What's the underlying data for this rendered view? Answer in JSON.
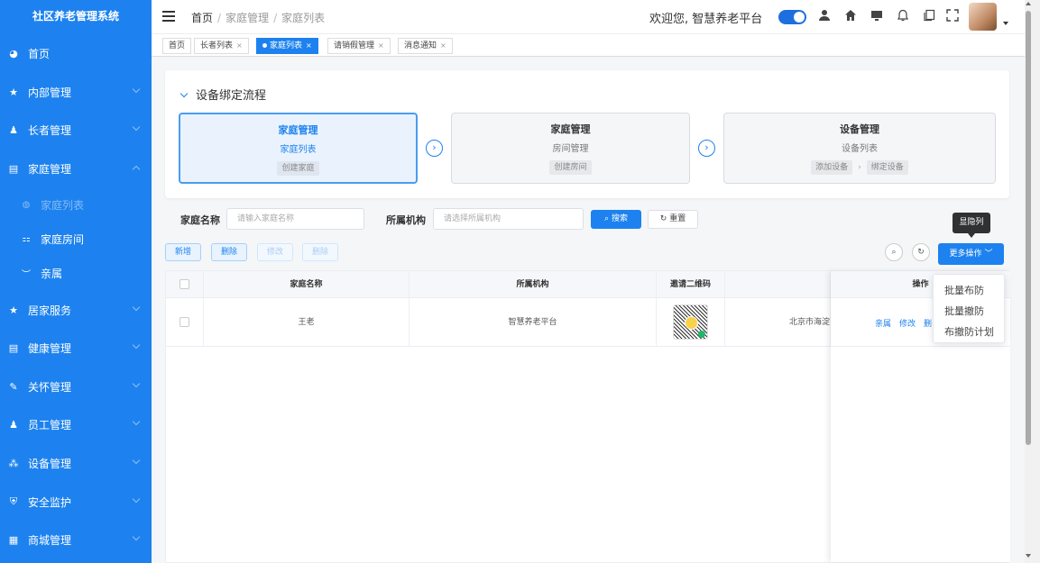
{
  "sidebar": {
    "brand": "社区养老管理系统",
    "items": [
      {
        "label": "首页",
        "icon": "dashboard-icon",
        "glyph": "◕"
      },
      {
        "label": "内部管理",
        "icon": "star-icon",
        "glyph": "★"
      },
      {
        "label": "长者管理",
        "icon": "user-icon",
        "glyph": "♟"
      },
      {
        "label": "家庭管理",
        "icon": "document-icon",
        "glyph": "▤"
      },
      {
        "label": "居家服务",
        "icon": "star-icon",
        "glyph": "★"
      },
      {
        "label": "健康管理",
        "icon": "document-icon",
        "glyph": "▤"
      },
      {
        "label": "关怀管理",
        "icon": "edit-icon",
        "glyph": "✎"
      },
      {
        "label": "员工管理",
        "icon": "user-icon",
        "glyph": "♟"
      },
      {
        "label": "设备管理",
        "icon": "device-icon",
        "glyph": "⁂"
      },
      {
        "label": "安全监护",
        "icon": "shield-icon",
        "glyph": "⛨"
      },
      {
        "label": "商城管理",
        "icon": "grid-icon",
        "glyph": "▦"
      }
    ],
    "subitems": [
      {
        "label": "家庭列表",
        "icon": "globe-icon",
        "glyph": "◍"
      },
      {
        "label": "家庭房间",
        "icon": "room-icon",
        "glyph": "⚏"
      },
      {
        "label": "亲属",
        "icon": "people-icon",
        "glyph": "︶"
      }
    ]
  },
  "header": {
    "breadcrumbs": [
      "首页",
      "家庭管理",
      "家庭列表"
    ],
    "welcome": "欢迎您, 智慧养老平台",
    "icons": [
      "person-icon",
      "home-icon",
      "monitor-icon",
      "bell-icon",
      "copy-icon",
      "fullscreen-icon"
    ]
  },
  "tabs": [
    {
      "label": "首页",
      "closable": false
    },
    {
      "label": "长者列表",
      "closable": true
    },
    {
      "label": "家庭列表",
      "closable": true,
      "active": true
    },
    {
      "label": "请销假管理",
      "closable": true
    },
    {
      "label": "消息通知",
      "closable": true
    }
  ],
  "flow": {
    "title": "设备绑定流程",
    "steps": [
      {
        "title": "家庭管理",
        "subtitle": "家庭列表",
        "buttons": [
          "创建家庭"
        ]
      },
      {
        "title": "家庭管理",
        "subtitle": "房间管理",
        "buttons": [
          "创建房间"
        ]
      },
      {
        "title": "设备管理",
        "subtitle": "设备列表",
        "buttons": [
          "添加设备",
          "绑定设备"
        ]
      }
    ]
  },
  "search": {
    "family_label": "家庭名称",
    "family_placeholder": "请输入家庭名称",
    "org_label": "所属机构",
    "org_placeholder": "请选择所属机构",
    "search_btn": "搜索",
    "reset_btn": "重置"
  },
  "toolbar": {
    "add": "新增",
    "delete": "删除",
    "edit": "修改",
    "remove": "删除",
    "more": "更多操作",
    "tooltip": "显隐列"
  },
  "table": {
    "headers": [
      "家庭名称",
      "所属机构",
      "邀请二维码",
      "",
      "操作"
    ],
    "rows": [
      {
        "name": "王老",
        "org": "智慧养老平台",
        "addr": "北京市海淀",
        "actions": [
          "亲属",
          "修改",
          "删"
        ]
      }
    ]
  },
  "dropdown": {
    "items": [
      "批量布防",
      "批量撤防",
      "布撤防计划"
    ]
  },
  "colors": {
    "primary": "#1d82ef",
    "sidebar": "#1d82ef"
  }
}
